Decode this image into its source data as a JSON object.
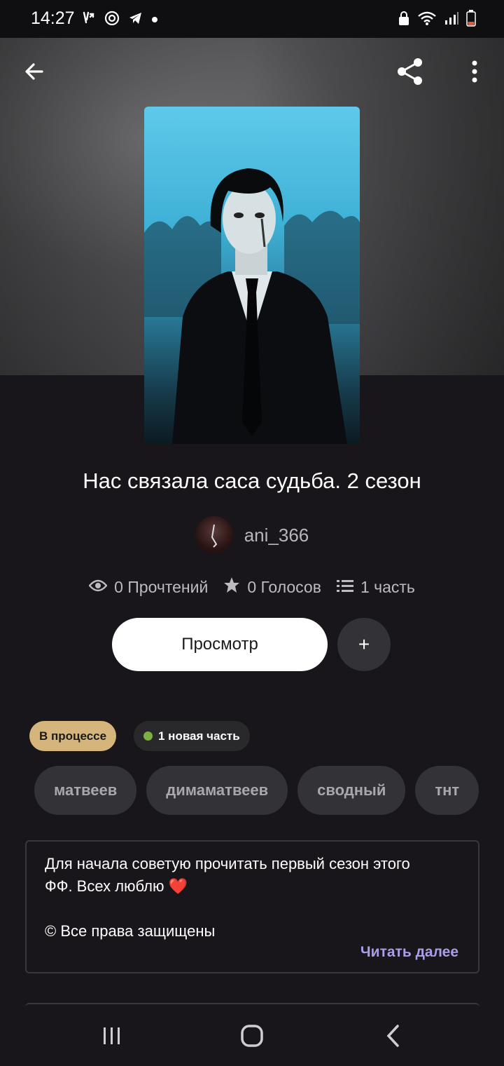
{
  "status_bar": {
    "time": "14:27",
    "icons_left": [
      "missed-call-icon",
      "vpn-icon",
      "telegram-icon",
      "dot-icon"
    ],
    "icons_right": [
      "lock-icon",
      "wifi-icon",
      "signal-icon",
      "battery-icon"
    ]
  },
  "header": {
    "back_icon": "arrow-left-icon",
    "share_icon": "share-icon",
    "menu_icon": "more-vertical-icon"
  },
  "book": {
    "title": "Нас связала саса судьба. 2 сезон",
    "author": "ani_366",
    "stats": {
      "reads": "0 Прочтений",
      "votes": "0 Голосов",
      "parts": "1 часть"
    },
    "view_button": "Просмотр",
    "add_button": "+",
    "status_badge": "В процессе",
    "new_part_badge": "1 новая часть",
    "tags": [
      "матвеев",
      "димаматвеев",
      "сводный",
      "тнт"
    ],
    "description": {
      "line1": "Для начала советую прочитать первый сезон этого",
      "line2": "ФФ. Всех люблю ❤️",
      "line3": "© Все права защищены",
      "read_more": "Читать далее"
    }
  },
  "colors": {
    "background": "#18161a",
    "status_badge": "#d6b57d",
    "new_dot": "#7bb23f",
    "read_more": "#a99ee8",
    "button_white": "#ffffff"
  },
  "nav": {
    "recents_icon": "recents-icon",
    "home_icon": "home-icon",
    "back_icon": "nav-back-icon"
  }
}
